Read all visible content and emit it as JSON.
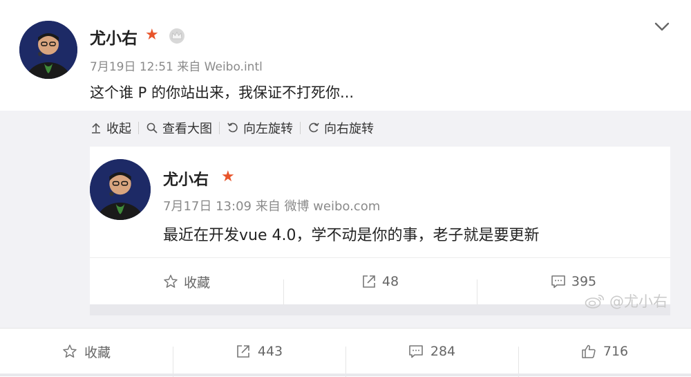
{
  "post": {
    "username": "尤小右",
    "date": "7月19日",
    "time": "12:51",
    "source_prefix": "来自",
    "source": "Weibo.intl",
    "text": "这个谁 P 的你站出来，我保证不打死你..."
  },
  "toolbar": {
    "collapse_label": "收起",
    "view_large_label": "查看大图",
    "rotate_left_label": "向左旋转",
    "rotate_right_label": "向右旋转"
  },
  "embedded": {
    "username": "尤小右",
    "date": "7月17日",
    "time": "13:09",
    "source_prefix": "来自",
    "source": "微博 weibo.com",
    "text": "最近在开发vue 4.0，学不动是你的事，老子就是要更新",
    "actions": {
      "favorite_label": "收藏",
      "repost_count": "48",
      "comment_count": "395"
    }
  },
  "watermark": {
    "text": "@尤小右"
  },
  "actions": {
    "favorite_label": "收藏",
    "repost_count": "443",
    "comment_count": "284",
    "like_count": "716"
  },
  "colors": {
    "accent_star": "#e8542a",
    "meta_gray": "#8a8a8a",
    "background_gray": "#f2f2f5"
  },
  "icons": {
    "verified": "red-star-icon",
    "vip": "crown-icon",
    "menu": "chevron-down-icon"
  }
}
